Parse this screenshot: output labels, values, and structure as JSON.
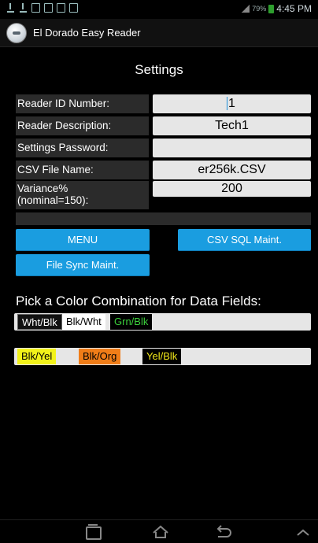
{
  "status_bar": {
    "battery_percent": "79%",
    "time": "4:45 PM"
  },
  "app": {
    "title": "El Dorado Easy Reader"
  },
  "page": {
    "title": "Settings"
  },
  "form": {
    "reader_id": {
      "label": "Reader ID Number:",
      "value": "1"
    },
    "reader_description": {
      "label": "Reader Description:",
      "value": "Tech1"
    },
    "settings_password": {
      "label": "Settings Password:",
      "value": ""
    },
    "csv_file_name": {
      "label": "CSV File Name:",
      "value": "er256k.CSV"
    },
    "variance": {
      "label_line1": "Variance%",
      "label_line2": "(nominal=150):",
      "value": "200"
    }
  },
  "buttons": {
    "menu": "MENU",
    "csv_sql_maint": "CSV SQL Maint.",
    "file_sync_maint": "File Sync Maint."
  },
  "color_picker": {
    "prompt": "Pick a Color Combination for Data Fields:",
    "group1": [
      "Wht/Blk",
      "Blk/Wht",
      "Grn/Blk"
    ],
    "group2": [
      "Blk/Yel",
      "Blk/Org",
      "Yel/Blk"
    ],
    "colors": {
      "button_blue": "#1a9de0",
      "yellow": "#f2f21a",
      "orange": "#f07d18",
      "green_text": "#3cd03c"
    }
  }
}
